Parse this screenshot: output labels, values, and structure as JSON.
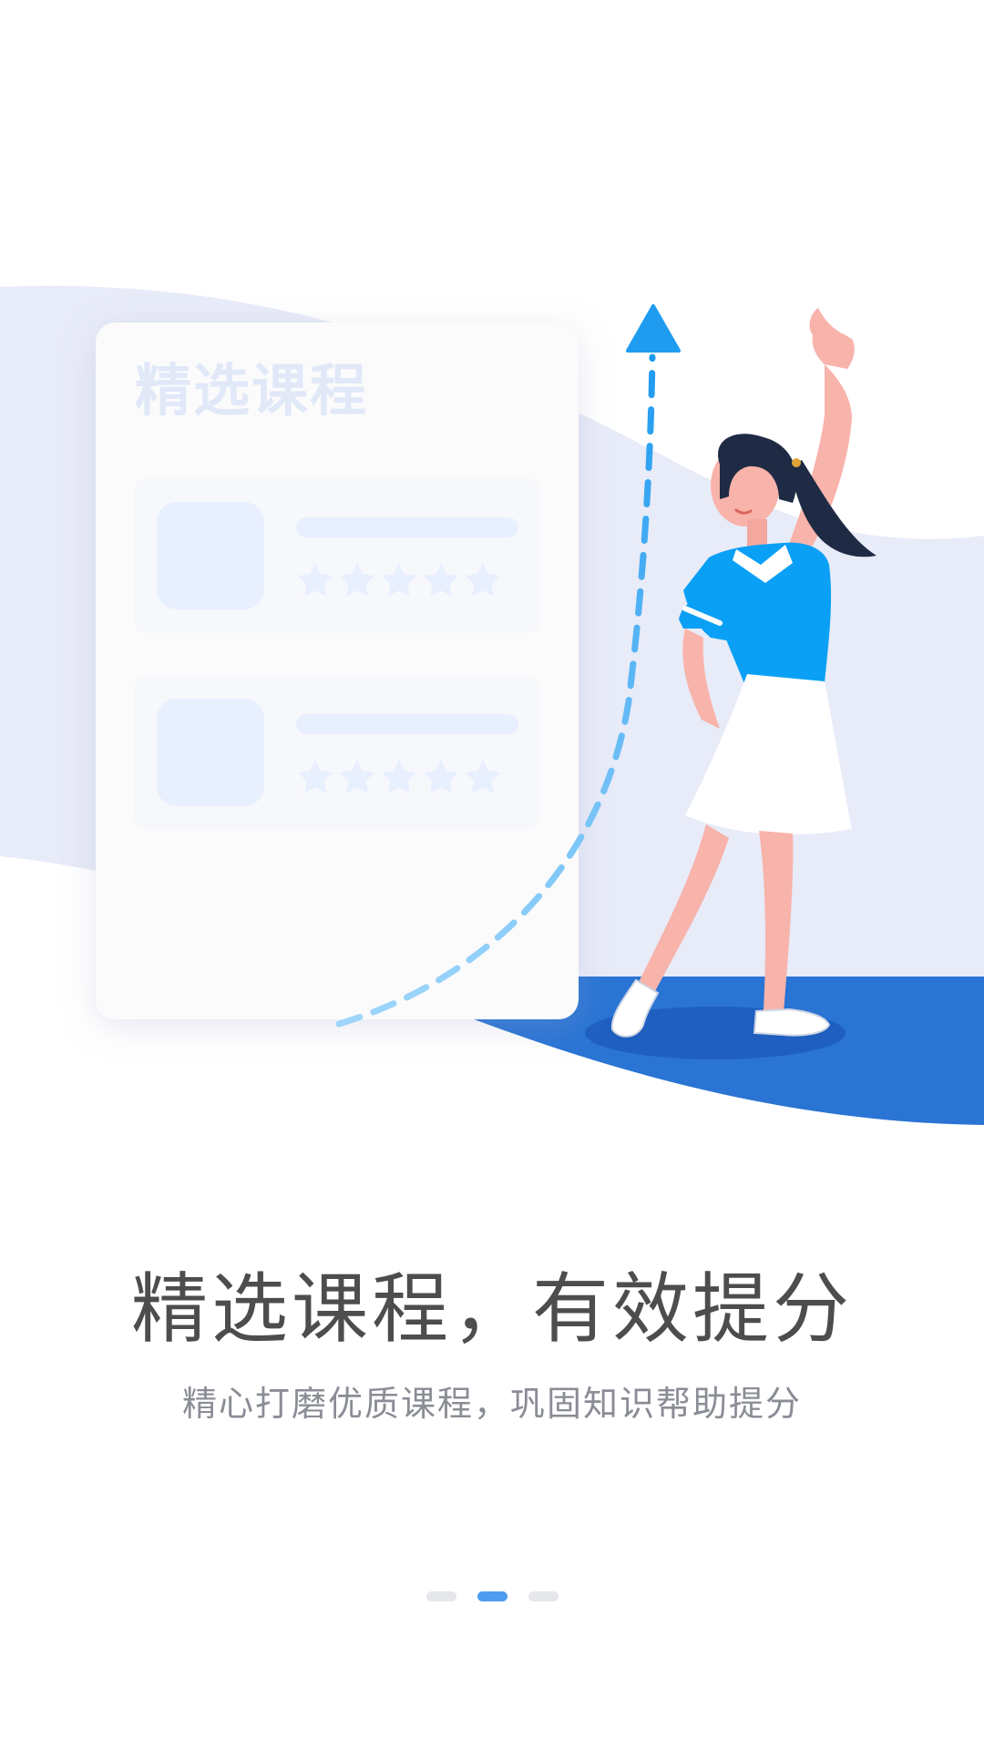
{
  "onboarding": {
    "card_title": "精选课程",
    "headline": "精选课程，有效提分",
    "subline": "精心打磨优质课程，巩固知识帮助提分",
    "pager": {
      "total": 3,
      "active_index": 1
    }
  },
  "colors": {
    "accent": "#4d9cf2",
    "wave_light": "#e8ebf8",
    "wave_dark": "#2a74d4",
    "shirt": "#0aa0f5",
    "arrow": "#1f9cf0"
  }
}
